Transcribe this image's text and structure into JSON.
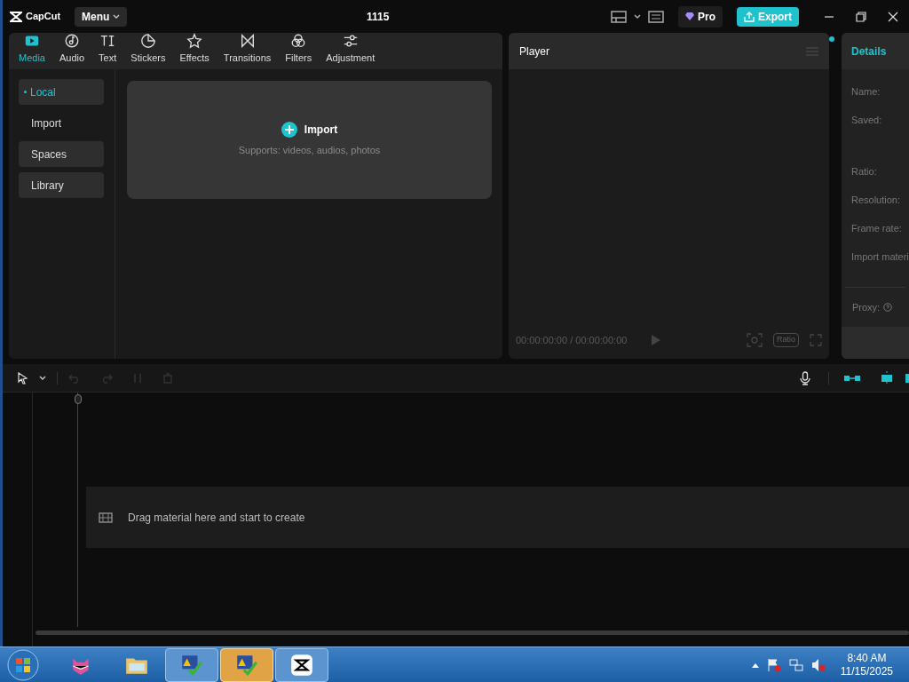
{
  "title_bar": {
    "logo_text": "CapCut",
    "menu_button": "Menu",
    "project_title": "1115",
    "pro_label": "Pro",
    "export_button": "Export"
  },
  "toolbar_tabs": [
    {
      "label": "Media",
      "kind": "media",
      "selected": true
    },
    {
      "label": "Audio",
      "kind": "audio",
      "selected": false
    },
    {
      "label": "Text",
      "kind": "text",
      "selected": false
    },
    {
      "label": "Stickers",
      "kind": "stickers",
      "selected": false
    },
    {
      "label": "Effects",
      "kind": "effects",
      "selected": false
    },
    {
      "label": "Transitions",
      "kind": "transitions",
      "selected": false
    },
    {
      "label": "Filters",
      "kind": "filters",
      "selected": false
    },
    {
      "label": "Adjustment",
      "kind": "adjustment",
      "selected": false
    }
  ],
  "media_sidebar": [
    {
      "label": "Local",
      "kind": "folder",
      "selected": true
    },
    {
      "label": "Import",
      "kind": "sub",
      "selected": false
    },
    {
      "label": "Spaces",
      "kind": "folder",
      "selected": false
    },
    {
      "label": "Library",
      "kind": "folder",
      "selected": false
    }
  ],
  "import_area": {
    "button": "Import",
    "hint": "Supports: videos, audios, photos"
  },
  "player": {
    "title": "Player",
    "timecode": "00:00:00:00 / 00:00:00:00",
    "ratio_button": "Ratio"
  },
  "details": {
    "title": "Details",
    "fields": [
      "Name:",
      "Saved:",
      "Ratio:",
      "Resolution:",
      "Frame rate:",
      "Import materi"
    ],
    "proxy": "Proxy:"
  },
  "timeline": {
    "empty_hint": "Drag material here and start to create"
  },
  "taskbar": {
    "apps": [
      {
        "kind": "cat",
        "selected": false
      },
      {
        "kind": "folder",
        "selected": false
      },
      {
        "kind": "warning",
        "selected": false
      },
      {
        "kind": "warning",
        "selected": true
      },
      {
        "kind": "capcut",
        "selected": false
      }
    ],
    "time": "8:40 AM",
    "date": "11/15/2025"
  }
}
